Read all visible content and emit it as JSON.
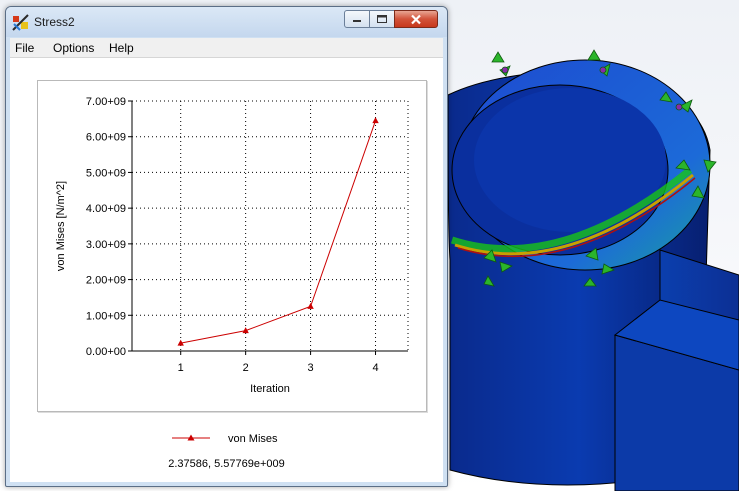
{
  "window": {
    "title": "Stress2",
    "icon": "stress-plot-app-icon"
  },
  "menu": {
    "items": [
      "File",
      "Options",
      "Help"
    ]
  },
  "chart_data": {
    "type": "line",
    "x": [
      1,
      2,
      3,
      4
    ],
    "series": [
      {
        "name": "von Mises",
        "values": [
          220000000.0,
          570000000.0,
          1250000000.0,
          6450000000.0
        ],
        "color": "#cc0000",
        "marker": "triangle"
      }
    ],
    "xlabel": "Iteration",
    "ylabel": "von Mises [N/m^2]",
    "xlim": [
      0.25,
      4.5
    ],
    "ylim": [
      0,
      7000000000.0
    ],
    "xticks": [
      "1",
      "2",
      "3",
      "4"
    ],
    "yticks": [
      "0.00+00",
      "1.00+09",
      "2.00+09",
      "3.00+09",
      "4.00+09",
      "5.00+09",
      "6.00+09",
      "7.00+09"
    ],
    "grid": true,
    "legend_position": "bottom"
  },
  "legend": {
    "label": "von Mises"
  },
  "status": {
    "coordinates": "2.37586, 5.57769e+009"
  },
  "colors": {
    "series": "#cc0000",
    "model_blue": "#0a2aa0",
    "fixture_green": "#2bb52b"
  }
}
